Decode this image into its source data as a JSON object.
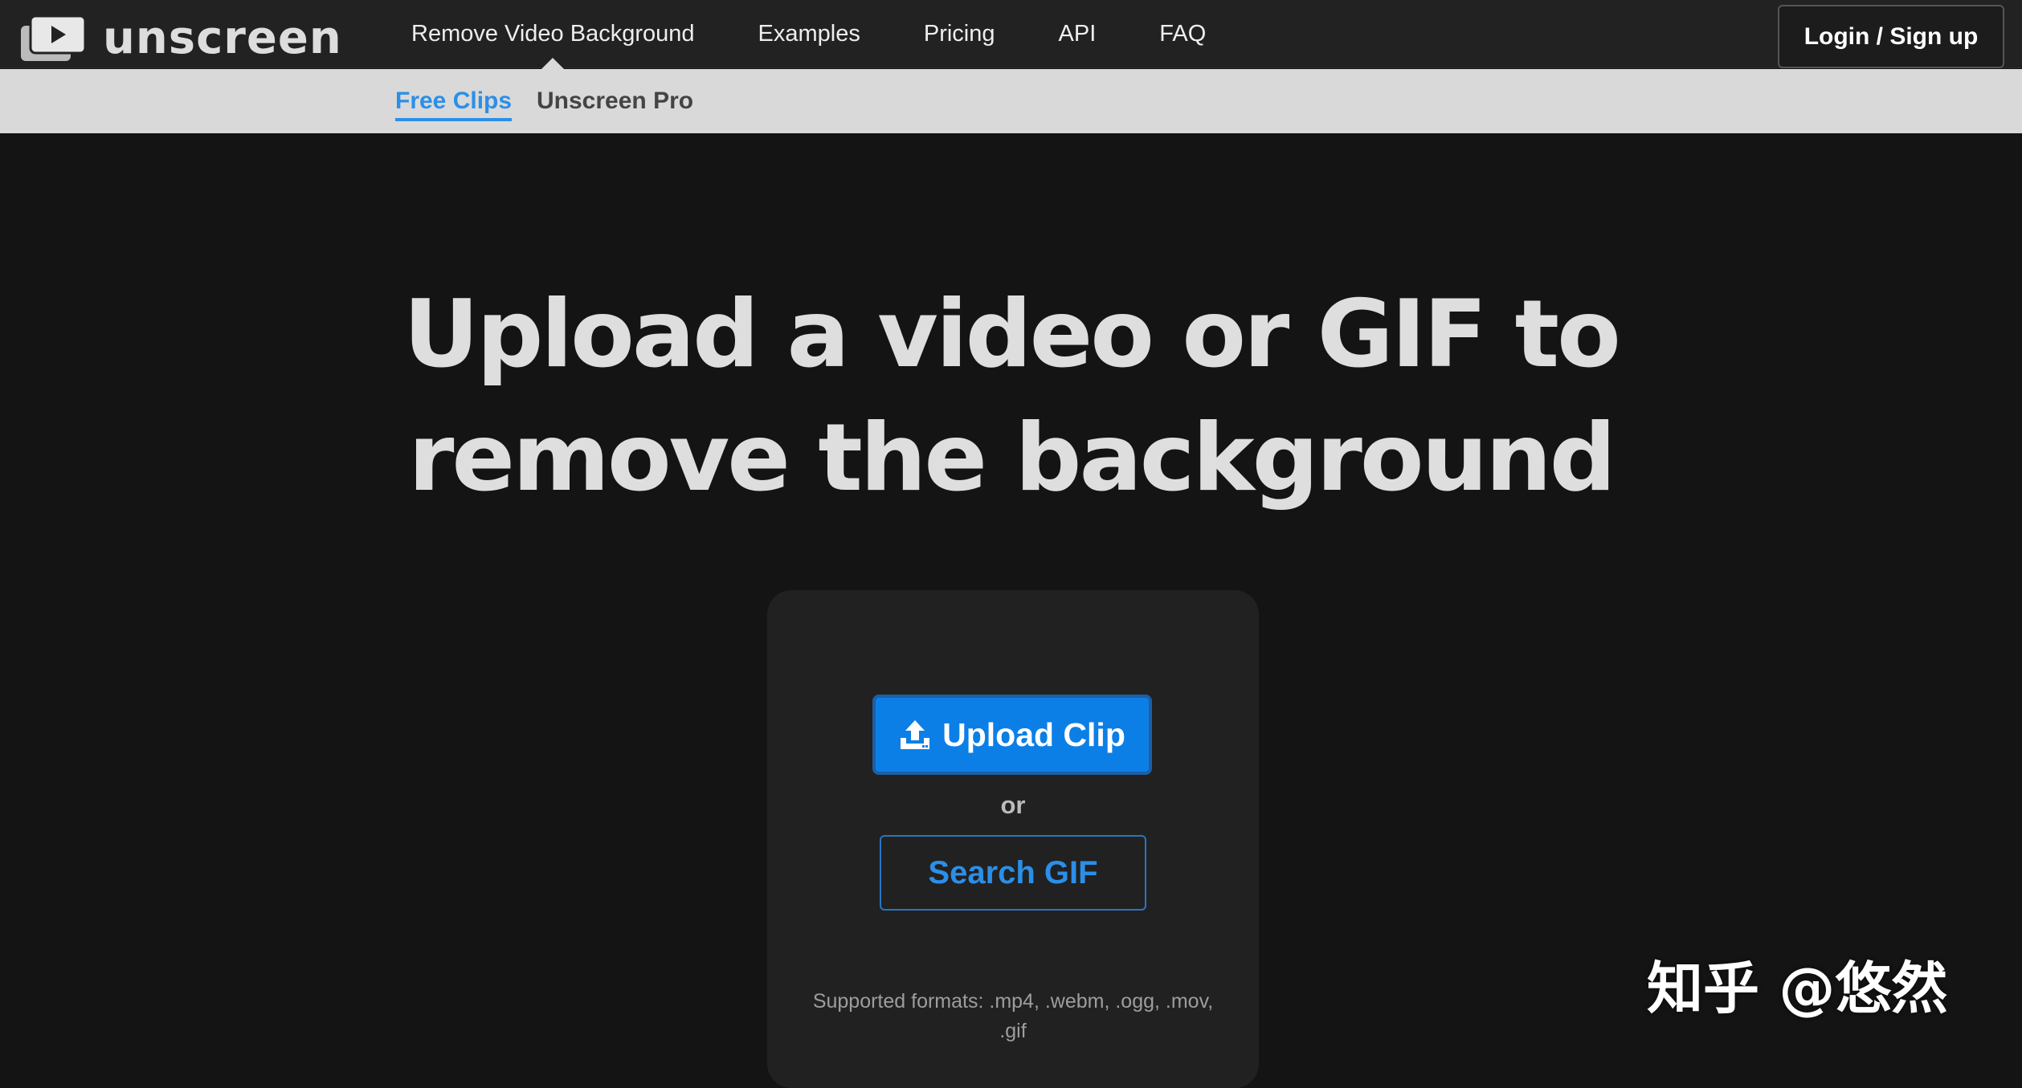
{
  "brand": {
    "name": "unscreen",
    "logo_icon": "play-window-icon"
  },
  "nav": {
    "items": [
      {
        "label": "Remove Video Background",
        "active": true
      },
      {
        "label": "Examples"
      },
      {
        "label": "Pricing"
      },
      {
        "label": "API"
      },
      {
        "label": "FAQ"
      }
    ],
    "login_label": "Login / Sign up"
  },
  "subnav": {
    "items": [
      {
        "label": "Free Clips",
        "active": true
      },
      {
        "label": "Unscreen Pro"
      }
    ]
  },
  "hero": {
    "line1": "Upload a video or GIF to",
    "line2": "remove the background"
  },
  "upload_card": {
    "upload_label": "Upload Clip",
    "upload_icon": "upload-icon",
    "or_label": "or",
    "search_label": "Search GIF",
    "formats_line1": "Supported formats: .mp4, .webm, .ogg, .mov,",
    "formats_line2": ".gif"
  },
  "watermark": {
    "text": "知乎 @悠然"
  },
  "colors": {
    "accent": "#0c7fe6",
    "link_blue": "#2b8fe8",
    "background": "#141414",
    "topbar": "#222222",
    "subbar": "#d9d9d9",
    "card": "#212121"
  }
}
